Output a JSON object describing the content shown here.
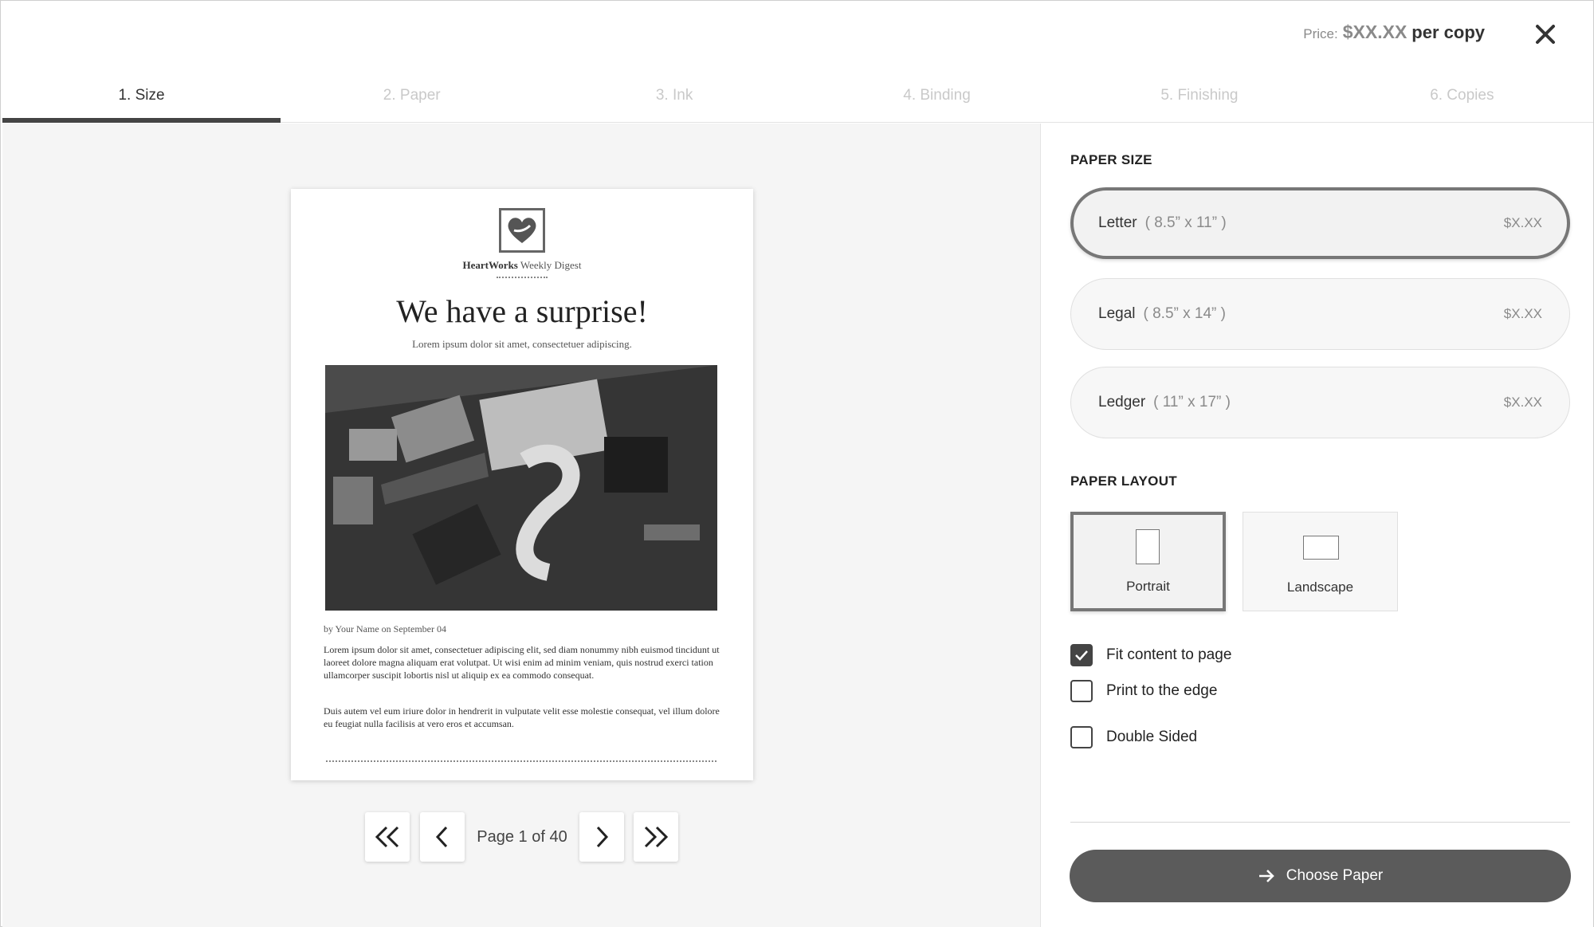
{
  "header": {
    "price_label": "Price:",
    "price_value": "$XX.XX",
    "price_unit": "per copy",
    "close_icon": "close-icon"
  },
  "tabs": [
    {
      "label": "1. Size",
      "active": true
    },
    {
      "label": "2. Paper",
      "active": false
    },
    {
      "label": "3. Ink",
      "active": false
    },
    {
      "label": "4. Binding",
      "active": false
    },
    {
      "label": "5. Finishing",
      "active": false
    },
    {
      "label": "6. Copies",
      "active": false
    }
  ],
  "preview": {
    "logo_icon": "heart-icon",
    "brand_bold": "HeartWorks",
    "brand_rest": " Weekly Digest",
    "headline": "We have a surprise!",
    "subheadline": "Lorem ipsum dolor sit amet, consectetuer adipiscing.",
    "byline": "by Your Name on September 04",
    "paragraph1": "Lorem ipsum dolor sit amet, consectetuer adipiscing elit, sed diam nonummy nibh euismod tincidunt ut laoreet dolore magna aliquam erat volutpat. Ut wisi enim ad minim veniam, quis nostrud exerci tation ullamcorper suscipit lobortis nisl ut aliquip ex ea commodo consequat.",
    "paragraph2": "Duis autem vel eum iriure dolor in hendrerit in vulputate velit esse molestie consequat, vel illum dolore eu feugiat nulla facilisis at vero eros et accumsan."
  },
  "pager": {
    "first_icon": "double-chevron-left-icon",
    "prev_icon": "chevron-left-icon",
    "page_text": "Page 1 of 40",
    "next_icon": "chevron-right-icon",
    "last_icon": "double-chevron-right-icon"
  },
  "panel": {
    "paper_size_title": "PAPER SIZE",
    "sizes": [
      {
        "name": "Letter",
        "dims": "( 8.5” x 11” )",
        "price": "$X.XX",
        "selected": true
      },
      {
        "name": "Legal",
        "dims": "( 8.5” x 14” )",
        "price": "$X.XX",
        "selected": false
      },
      {
        "name": "Ledger",
        "dims": "( 11” x 17” )",
        "price": "$X.XX",
        "selected": false
      }
    ],
    "paper_layout_title": "PAPER LAYOUT",
    "layouts": [
      {
        "label": "Portrait",
        "selected": true
      },
      {
        "label": "Landscape",
        "selected": false
      }
    ],
    "options": [
      {
        "label": "Fit content to page",
        "checked": true
      },
      {
        "label": "Print to the edge",
        "checked": false
      },
      {
        "label": "Double Sided",
        "checked": false
      }
    ],
    "cta_label": "Choose Paper",
    "cta_icon": "arrow-right-icon"
  }
}
